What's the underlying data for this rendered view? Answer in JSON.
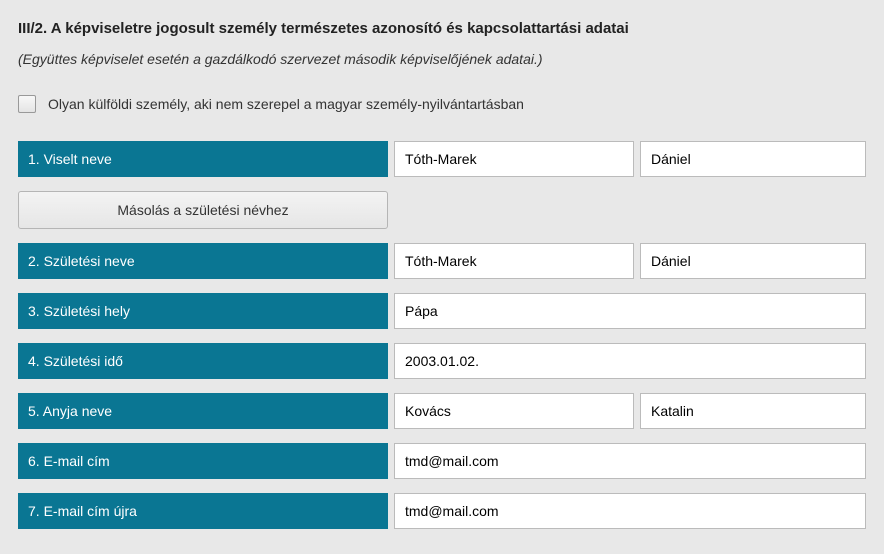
{
  "section": {
    "title": "III/2. A képviseletre jogosult személy természetes azonosító és kapcsolattartási adatai",
    "subtitle": "(Együttes képviselet esetén a gazdálkodó szervezet második képviselőjének adatai.)"
  },
  "foreign_checkbox": {
    "label": "Olyan külföldi személy, aki nem szerepel a magyar személy-nyilvántartásban",
    "checked": false
  },
  "rows": {
    "name": {
      "label": "1. Viselt neve",
      "surname": "Tóth-Marek",
      "given": "Dániel"
    },
    "copy_button": "Másolás a születési névhez",
    "birth_name": {
      "label": "2. Születési neve",
      "surname": "Tóth-Marek",
      "given": "Dániel"
    },
    "birth_place": {
      "label": "3. Születési hely",
      "value": "Pápa"
    },
    "birth_date": {
      "label": "4. Születési idő",
      "value": "2003.01.02."
    },
    "mother_name": {
      "label": "5. Anyja neve",
      "surname": "Kovács",
      "given": "Katalin"
    },
    "email": {
      "label": "6. E-mail cím",
      "value": "tmd@mail.com"
    },
    "email_confirm": {
      "label": "7. E-mail cím újra",
      "value": "tmd@mail.com"
    }
  }
}
